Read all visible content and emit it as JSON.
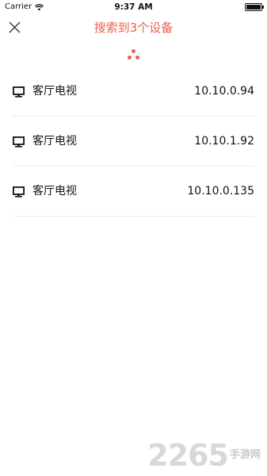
{
  "status_bar": {
    "carrier": "Carrier",
    "time": "9:37 AM",
    "wifi_icon": "wifi-icon",
    "battery_icon": "battery-icon"
  },
  "header": {
    "title": "搜索到3个设备",
    "close_icon": "close-icon",
    "accent_color": "#e8624c"
  },
  "loader": {
    "icon": "loading-dots-icon"
  },
  "devices": [
    {
      "icon": "monitor-icon",
      "name": "客厅电视",
      "ip": "10.10.0.94"
    },
    {
      "icon": "monitor-icon",
      "name": "客厅电视",
      "ip": "10.10.1.92"
    },
    {
      "icon": "monitor-icon",
      "name": "客厅电视",
      "ip": "10.10.0.135"
    }
  ],
  "watermark": {
    "number": "2265",
    "suffix": "手游网"
  }
}
